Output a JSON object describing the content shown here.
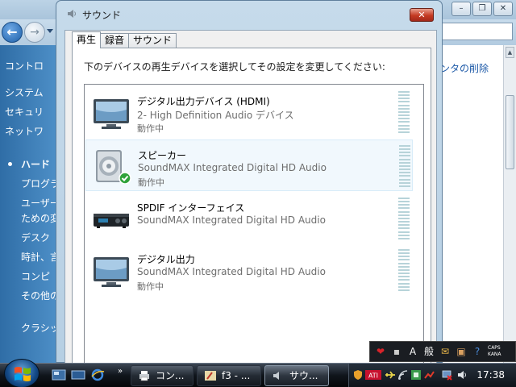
{
  "background_window": {
    "left_nav": [
      "コントロ",
      "システム",
      "セキュリ",
      "ネットワ",
      "ハード",
      "プログラ",
      "ユーザー",
      "ための変",
      "デスク",
      "時計、言",
      "コンピ",
      "その他の",
      "クラシッ"
    ],
    "right_link": "ンタの削除"
  },
  "dialog": {
    "title": "サウンド",
    "close_label": "✕",
    "tabs": [
      {
        "label": "再生",
        "active": true
      },
      {
        "label": "録音",
        "active": false
      },
      {
        "label": "サウンド",
        "active": false
      }
    ],
    "instruction": "下のデバイスの再生デバイスを選択してその設定を変更してください:",
    "devices": [
      {
        "name": "デジタル出力デバイス (HDMI)",
        "desc": "2- High Definition Audio デバイス",
        "status": "動作中",
        "icon": "monitor-icon",
        "selected": false
      },
      {
        "name": "スピーカー",
        "desc": "SoundMAX Integrated Digital HD Audio",
        "status": "動作中",
        "icon": "speaker-icon",
        "selected": true,
        "default": true
      },
      {
        "name": "SPDIF インターフェイス",
        "desc": "SoundMAX Integrated Digital HD Audio",
        "status": "",
        "icon": "receiver-icon",
        "selected": false
      },
      {
        "name": "デジタル出力",
        "desc": "SoundMAX Integrated Digital HD Audio",
        "status": "動作中",
        "icon": "monitor-icon",
        "selected": false
      }
    ]
  },
  "ime_bar": {
    "mode": "A",
    "kanji": "般",
    "caps": "CAPS",
    "kana": "KANA"
  },
  "taskbar": {
    "tasks": [
      "コン...",
      "f3 - ...",
      "サウ..."
    ],
    "quicklaunch_more": "»",
    "clock": "17:38"
  }
}
